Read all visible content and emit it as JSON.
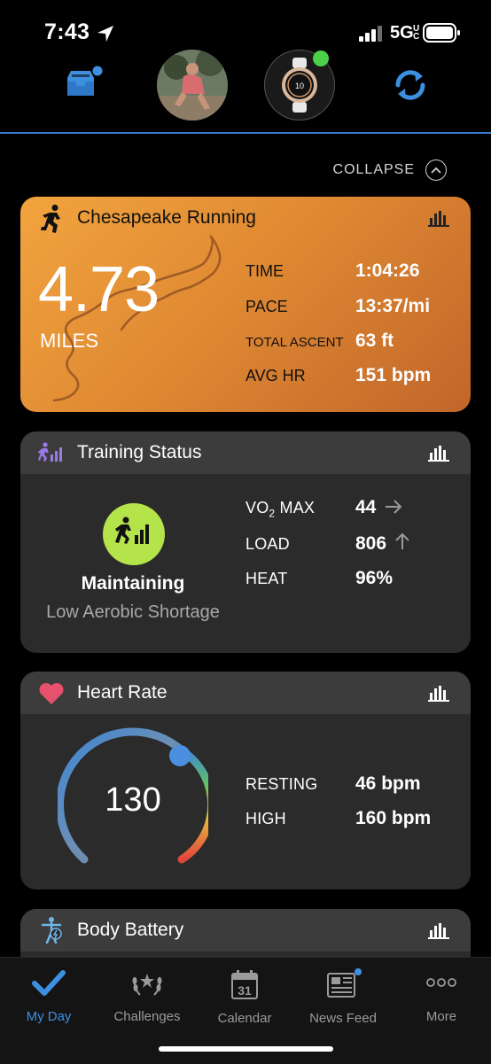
{
  "status": {
    "time": "7:43",
    "network": "5G"
  },
  "collapse_label": "COLLAPSE",
  "activity": {
    "title": "Chesapeake Running",
    "distance": "4.73",
    "distance_unit": "MILES",
    "stats": [
      {
        "label": "TIME",
        "value": "1:04:26"
      },
      {
        "label": "PACE",
        "value": "13:37/mi"
      },
      {
        "label": "TOTAL ASCENT",
        "value": "63 ft"
      },
      {
        "label": "AVG HR",
        "value": "151 bpm"
      }
    ]
  },
  "training": {
    "title": "Training Status",
    "status": "Maintaining",
    "subtitle": "Low Aerobic Shortage",
    "vo2_label_main": "VO",
    "vo2_label_sub": "2",
    "vo2_label_rest": " MAX",
    "vo2_value": "44",
    "load_label": "LOAD",
    "load_value": "806",
    "heat_label": "HEAT",
    "heat_value": "96%"
  },
  "heart": {
    "title": "Heart Rate",
    "current": "130",
    "resting_label": "RESTING",
    "resting_value": "46 bpm",
    "high_label": "HIGH",
    "high_value": "160 bpm"
  },
  "battery": {
    "title": "Body Battery"
  },
  "tabs": [
    {
      "label": "My Day",
      "icon": "check-icon",
      "active": true
    },
    {
      "label": "Challenges",
      "icon": "laurel-icon",
      "active": false
    },
    {
      "label": "Calendar",
      "icon": "calendar-icon",
      "active": false,
      "day": "31"
    },
    {
      "label": "News Feed",
      "icon": "newspaper-icon",
      "active": false
    },
    {
      "label": "More",
      "icon": "more-icon",
      "active": false
    }
  ],
  "colors": {
    "accent": "#3d8fe0",
    "run_card": "#e89338",
    "training_badge": "#b5e34a",
    "heart": "#e8516b"
  }
}
